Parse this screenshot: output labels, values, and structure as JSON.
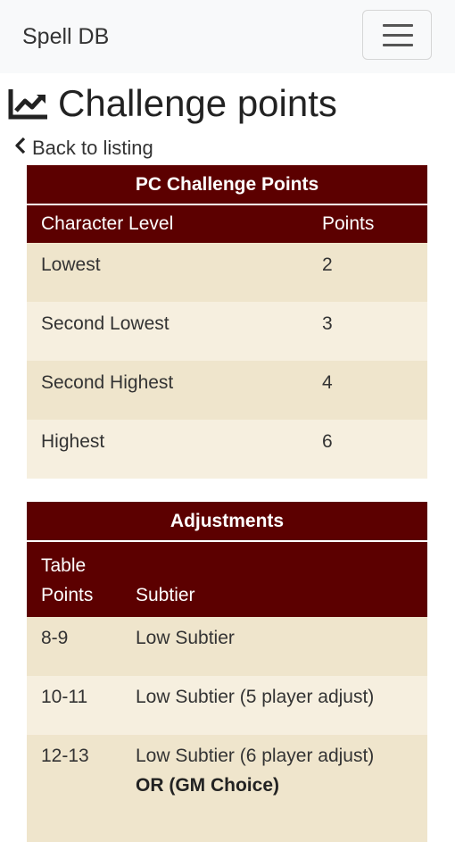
{
  "navbar": {
    "brand": "Spell DB",
    "toggle_icon": "hamburger-menu-icon"
  },
  "header": {
    "title": "Challenge points",
    "title_icon": "line-chart-icon"
  },
  "back_link": {
    "label": "Back to listing",
    "icon": "chevron-left-icon"
  },
  "pc_table": {
    "caption": "PC Challenge Points",
    "headers": [
      "Character Level",
      "Points"
    ],
    "rows": [
      [
        "Lowest",
        "2"
      ],
      [
        "Second Lowest",
        "3"
      ],
      [
        "Second Highest",
        "4"
      ],
      [
        "Highest",
        "6"
      ]
    ]
  },
  "adjust_table": {
    "caption": "Adjustments",
    "headers": [
      "Table Points",
      "Subtier"
    ],
    "rows": [
      [
        "8-9",
        "Low Subtier"
      ],
      [
        "10-11",
        "Low Subtier (5 player adjust)"
      ],
      [
        "12-13",
        "Low Subtier (6 player adjust)"
      ]
    ],
    "row3_extra": "OR (GM Choice)"
  },
  "colors": {
    "table_header": "#5c0000",
    "row_odd": "#efe5cc",
    "row_even": "#f6efdf",
    "navbar_bg": "#f8f9fa"
  }
}
